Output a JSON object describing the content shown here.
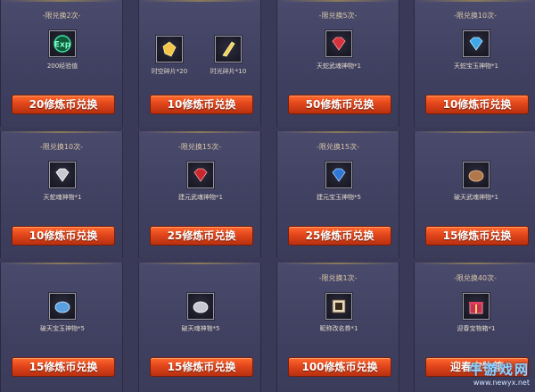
{
  "colors": {
    "background": "#3a3a58",
    "button": "#e2461c",
    "limit_text": "#d8c8a8"
  },
  "cards": [
    {
      "limit": "-限兑换2次-",
      "items": [
        {
          "icon": "exp-badge-icon",
          "label": "200经验值"
        }
      ],
      "button": "20修炼币兑换"
    },
    {
      "limit": "",
      "items": [
        {
          "icon": "spacetime-shard-icon",
          "label": "时空碎片*20"
        },
        {
          "icon": "light-shard-icon",
          "label": "时光碎片*10"
        }
      ],
      "button": "10修炼币兑换"
    },
    {
      "limit": "-限兑换5次-",
      "items": [
        {
          "icon": "red-gem-icon",
          "label": "天蛇武魂神物*1"
        }
      ],
      "button": "50修炼币兑换"
    },
    {
      "limit": "-限兑换10次-",
      "items": [
        {
          "icon": "blue-gem-icon",
          "label": "天蛇宝玉神物*1"
        }
      ],
      "button": "10修炼币兑换"
    },
    {
      "limit": "-限兑换10次-",
      "items": [
        {
          "icon": "silver-gem-icon",
          "label": "天蛇魂神物*1"
        }
      ],
      "button": "10修炼币兑换"
    },
    {
      "limit": "-限兑换15次-",
      "items": [
        {
          "icon": "red-gem-icon",
          "label": "建元武魂神物*1"
        }
      ],
      "button": "25修炼币兑换"
    },
    {
      "limit": "-限兑换15次-",
      "items": [
        {
          "icon": "blue-gem-icon",
          "label": "建元宝玉神物*5"
        }
      ],
      "button": "25修炼币兑换"
    },
    {
      "limit": "",
      "items": [
        {
          "icon": "bronze-gem-icon",
          "label": "破天武魂神物*1"
        }
      ],
      "button": "15修炼币兑换"
    },
    {
      "limit": "",
      "items": [
        {
          "icon": "blue-gem-icon",
          "label": "破天宝玉神物*5"
        }
      ],
      "button": "15修炼币兑换"
    },
    {
      "limit": "",
      "items": [
        {
          "icon": "silver-gem-icon",
          "label": "破天魂神物*5"
        }
      ],
      "button": "15修炼币兑换"
    },
    {
      "limit": "-限兑换1次-",
      "items": [
        {
          "icon": "rename-card-icon",
          "label": "昵称改名券*1"
        }
      ],
      "button": "100修炼币兑换"
    },
    {
      "limit": "-限兑换40次-",
      "items": [
        {
          "icon": "gift-box-icon",
          "label": "迎春宝物箱*1"
        }
      ],
      "button": "迎春宝物箱"
    }
  ],
  "watermark": {
    "title": "牛游戏网",
    "url": "www.newyx.net"
  }
}
